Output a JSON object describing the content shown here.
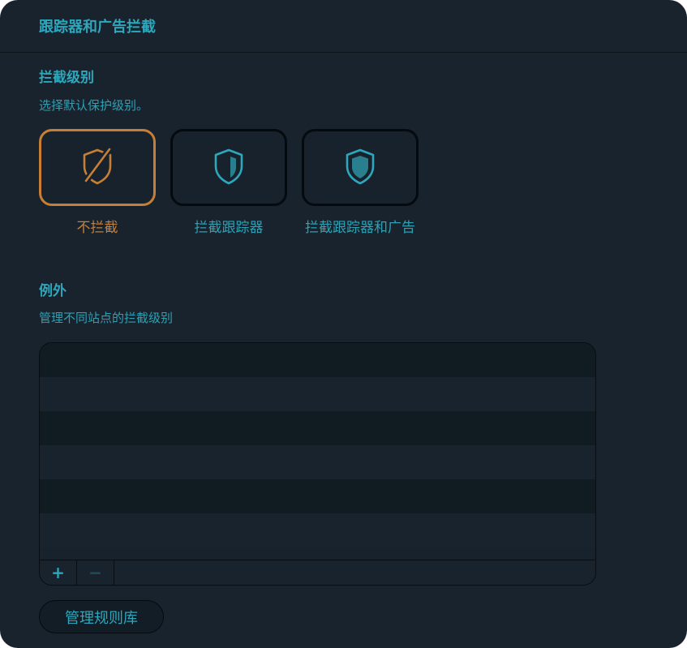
{
  "panel": {
    "title": "跟踪器和广告拦截"
  },
  "blocking_level": {
    "title": "拦截级别",
    "description": "选择默认保护级别。",
    "options": [
      {
        "label": "不拦截",
        "icon": "shield-off-icon",
        "selected": true
      },
      {
        "label": "拦截跟踪器",
        "icon": "shield-half-icon",
        "selected": false
      },
      {
        "label": "拦截跟踪器和广告",
        "icon": "shield-full-icon",
        "selected": false
      }
    ]
  },
  "exceptions": {
    "title": "例外",
    "description": "管理不同站点的拦截级别",
    "rows": [],
    "add_label": "+",
    "remove_label": "−"
  },
  "manage_rules_button": "管理规则库",
  "colors": {
    "background": "#18232d",
    "accent": "#2ea6bb",
    "selected": "#c77f36",
    "border": "#050a0e"
  }
}
